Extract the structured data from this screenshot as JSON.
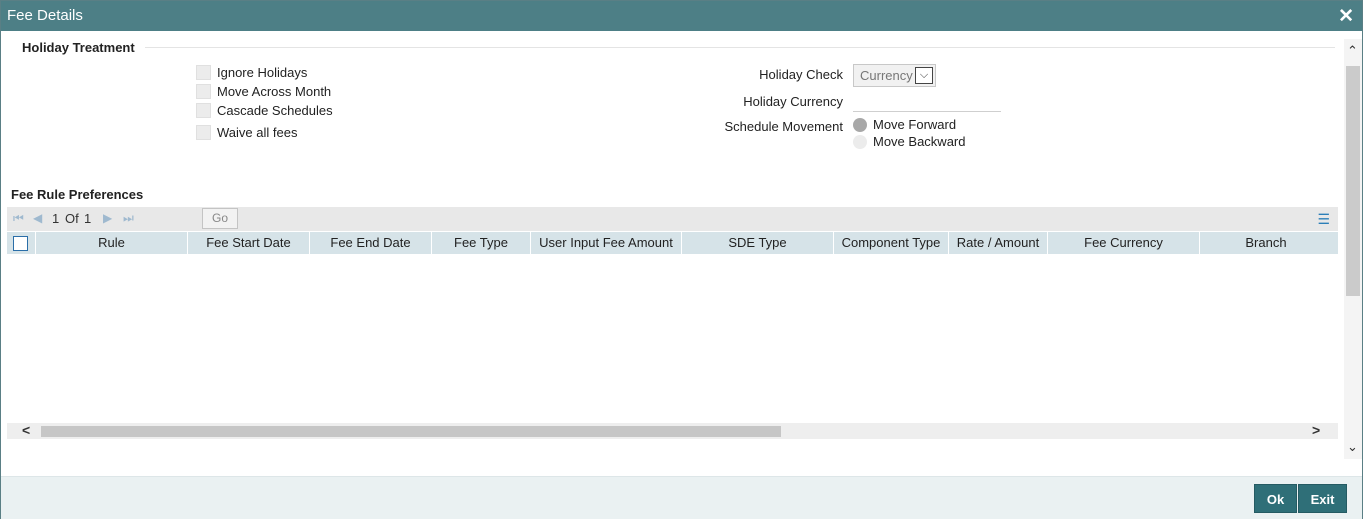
{
  "window": {
    "title": "Fee Details"
  },
  "holiday_treatment": {
    "title": "Holiday Treatment",
    "checkboxes": [
      "Ignore Holidays",
      "Move Across Month",
      "Cascade Schedules",
      "Waive all fees"
    ],
    "holiday_check_label": "Holiday Check",
    "holiday_check_value": "Currency",
    "holiday_currency_label": "Holiday Currency",
    "holiday_currency_value": "",
    "schedule_movement_label": "Schedule Movement",
    "schedule_movement_options": [
      "Move Forward",
      "Move Backward"
    ],
    "schedule_movement_selected": "Move Forward"
  },
  "fee_rule_preferences": {
    "title": "Fee Rule Preferences",
    "pagination": {
      "current": "1",
      "of_label": "Of",
      "total": "1",
      "go_label": "Go"
    },
    "columns": [
      "Rule",
      "Fee Start Date",
      "Fee End Date",
      "Fee Type",
      "User Input Fee Amount",
      "SDE Type",
      "Component Type",
      "Rate / Amount",
      "Fee Currency",
      "Branch"
    ],
    "rows": []
  },
  "footer": {
    "ok_label": "Ok",
    "exit_label": "Exit"
  },
  "colors": {
    "titlebar": "#4d7f86",
    "button": "#2f6f78",
    "grid_header": "#d6e3e8"
  }
}
